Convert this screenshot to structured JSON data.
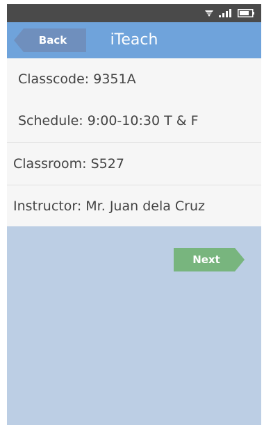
{
  "app_bar": {
    "title": "iTeach",
    "back_label": "Back"
  },
  "status_bar": {
    "icons": [
      "wifi-icon",
      "signal-icon",
      "battery-icon"
    ]
  },
  "class_info": {
    "classcode": "Classcode: 9351A",
    "schedule": "Schedule: 9:00-10:30 T & F",
    "classroom": "Classroom: S527",
    "instructor": "Instructor: Mr. Juan dela Cruz"
  },
  "actions": {
    "next_label": "Next"
  },
  "colors": {
    "status_bar": "#4a4a4a",
    "app_bar": "#6fa3db",
    "back_button": "#6f8fbd",
    "list_background": "#f6f6f6",
    "screen_background": "#bccee4",
    "next_button": "#78b57e"
  }
}
